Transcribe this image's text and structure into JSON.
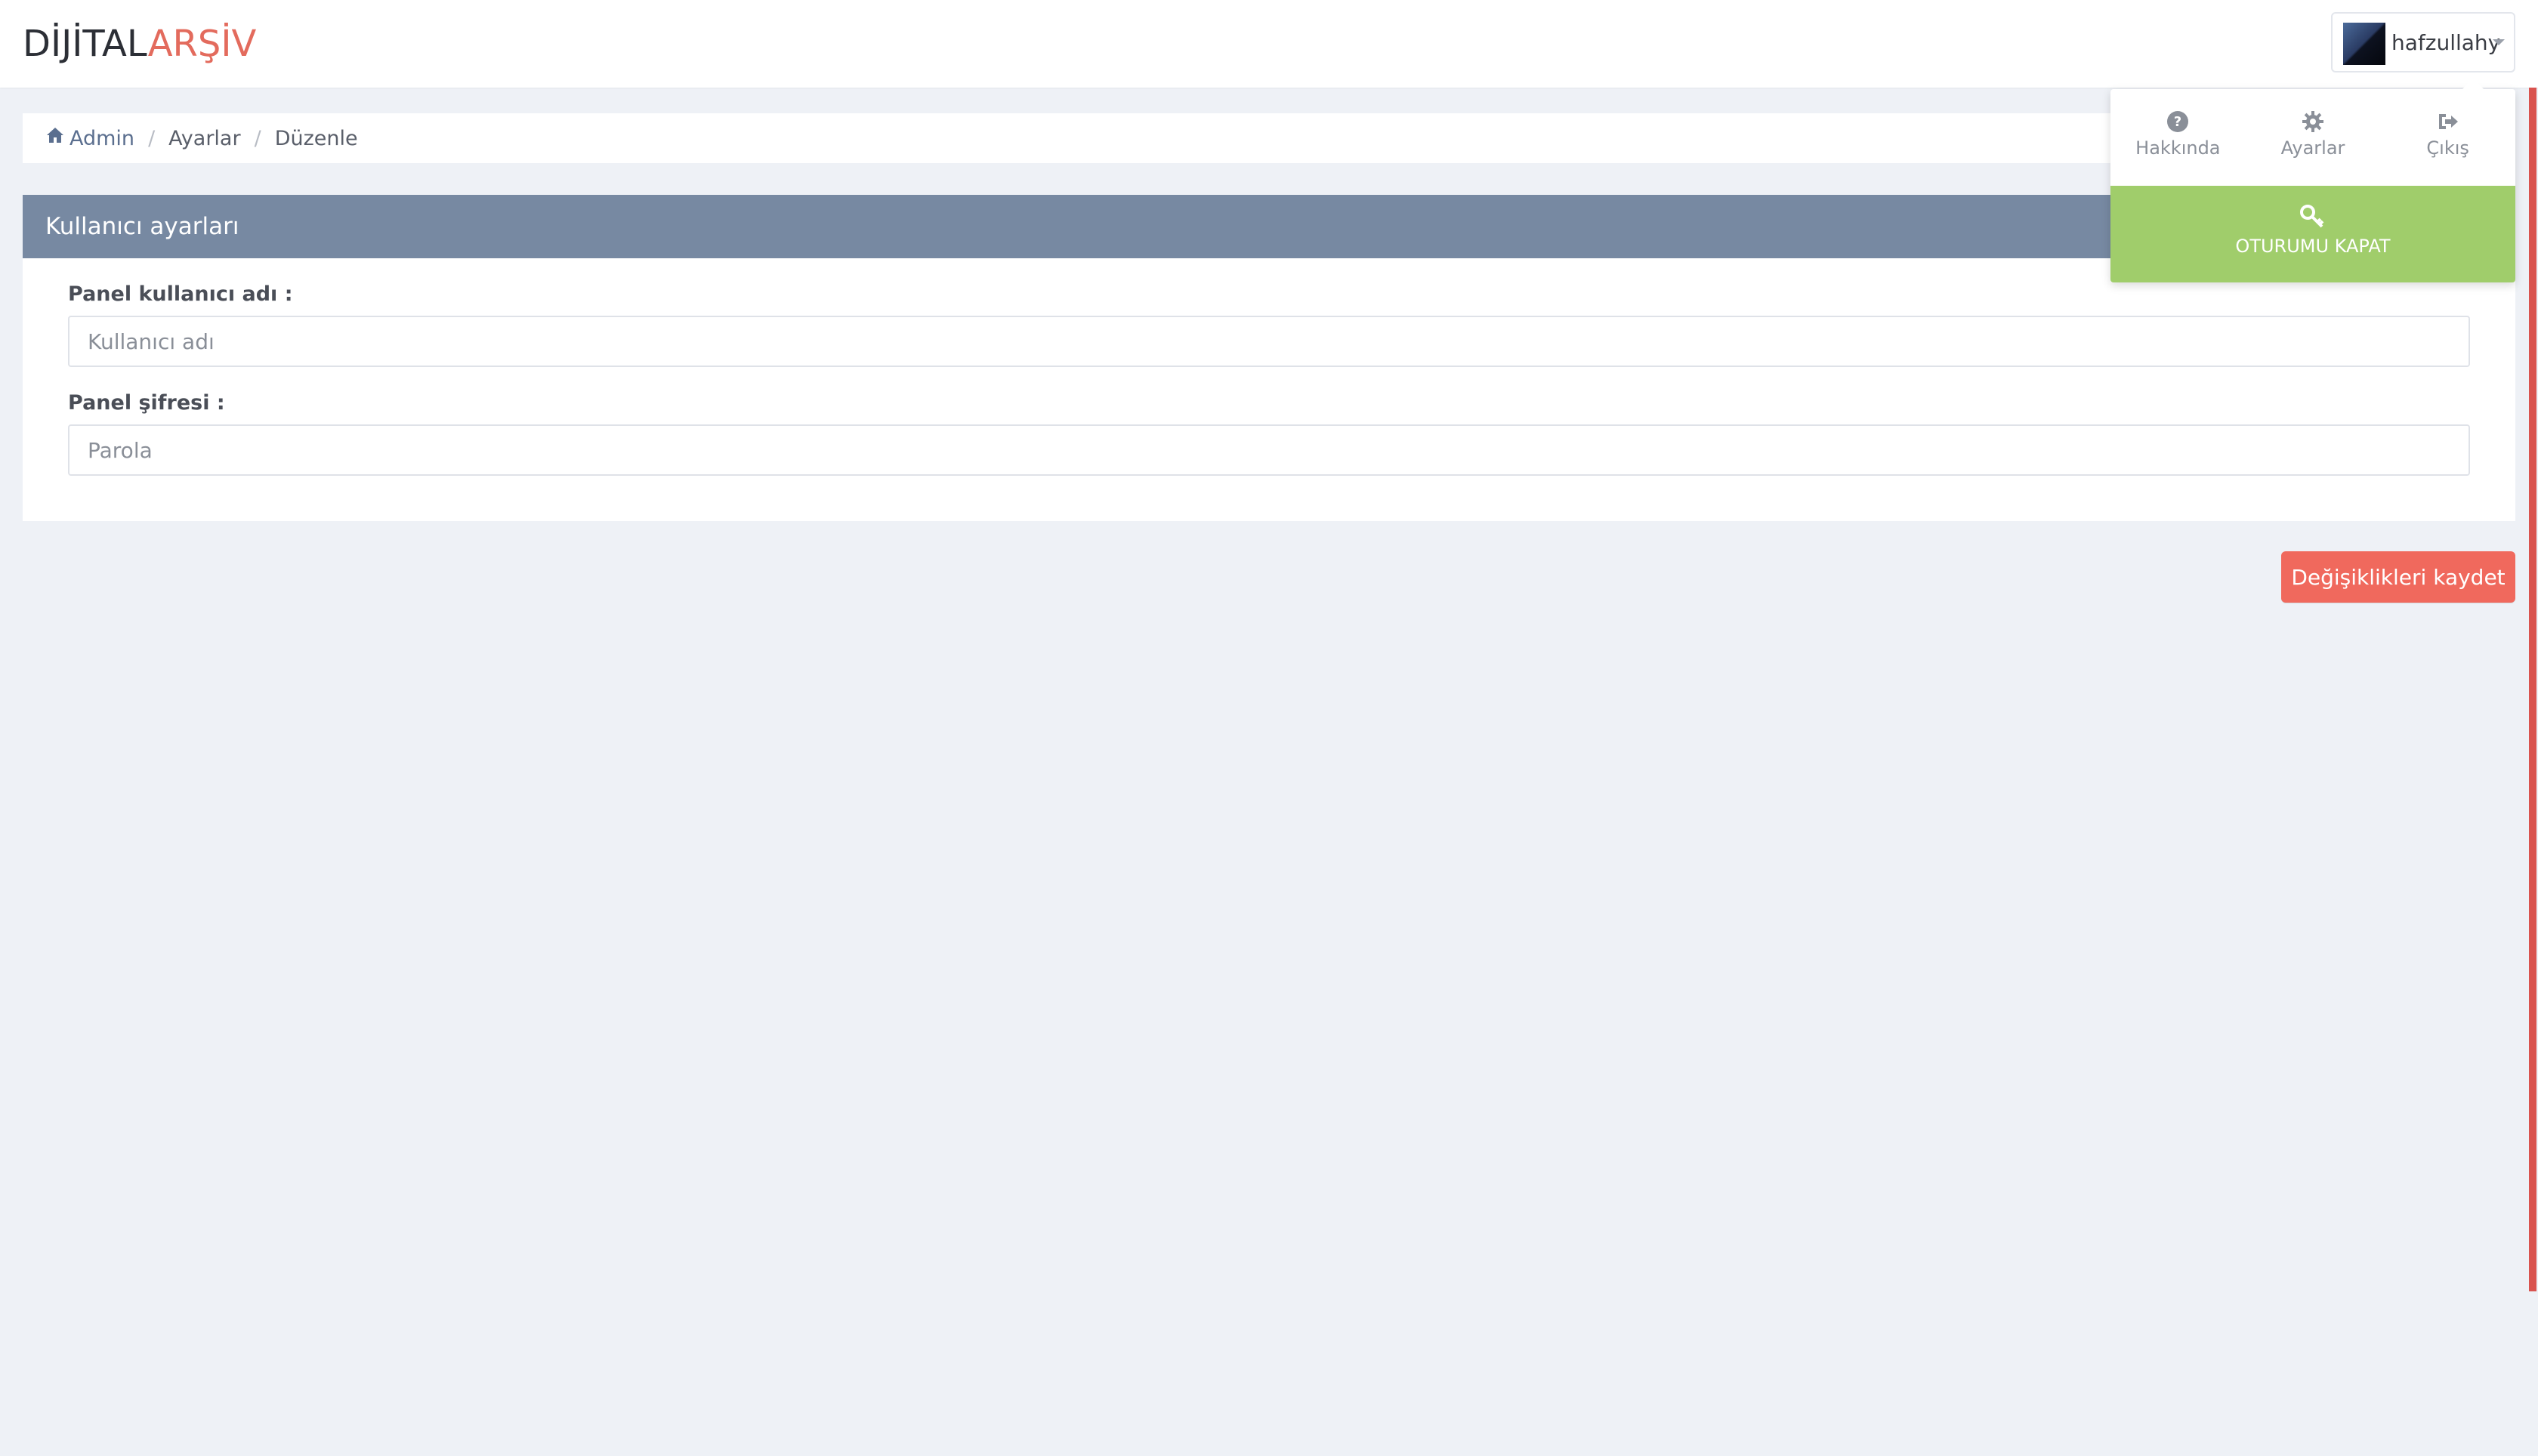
{
  "brand": {
    "part1": "DİJİTAL",
    "part2": "ARŞİV"
  },
  "user": {
    "name": "hafzullahy"
  },
  "breadcrumb": {
    "items": [
      "Admin",
      "Ayarlar",
      "Düzenle"
    ]
  },
  "panel": {
    "title": "Kullanıcı ayarları",
    "username_label": "Panel kullanıcı adı :",
    "username_placeholder": "Kullanıcı adı",
    "password_label": "Panel şifresi :",
    "password_placeholder": "Parola"
  },
  "actions": {
    "save_label": "Değişiklikleri kaydet"
  },
  "dropdown": {
    "items": [
      {
        "label": "Hakkında",
        "icon": "question-circle-icon"
      },
      {
        "label": "Ayarlar",
        "icon": "gear-icon"
      },
      {
        "label": "Çıkış",
        "icon": "sign-out-icon"
      }
    ],
    "logout_label": "OTURUMU KAPAT",
    "logout_icon": "key-icon"
  },
  "colors": {
    "brand_accent": "#e36b5d",
    "panel_header": "#7789a2",
    "save_button": "#f0695d",
    "logout_bg": "#a0cd6b",
    "page_bg": "#eef1f6"
  }
}
